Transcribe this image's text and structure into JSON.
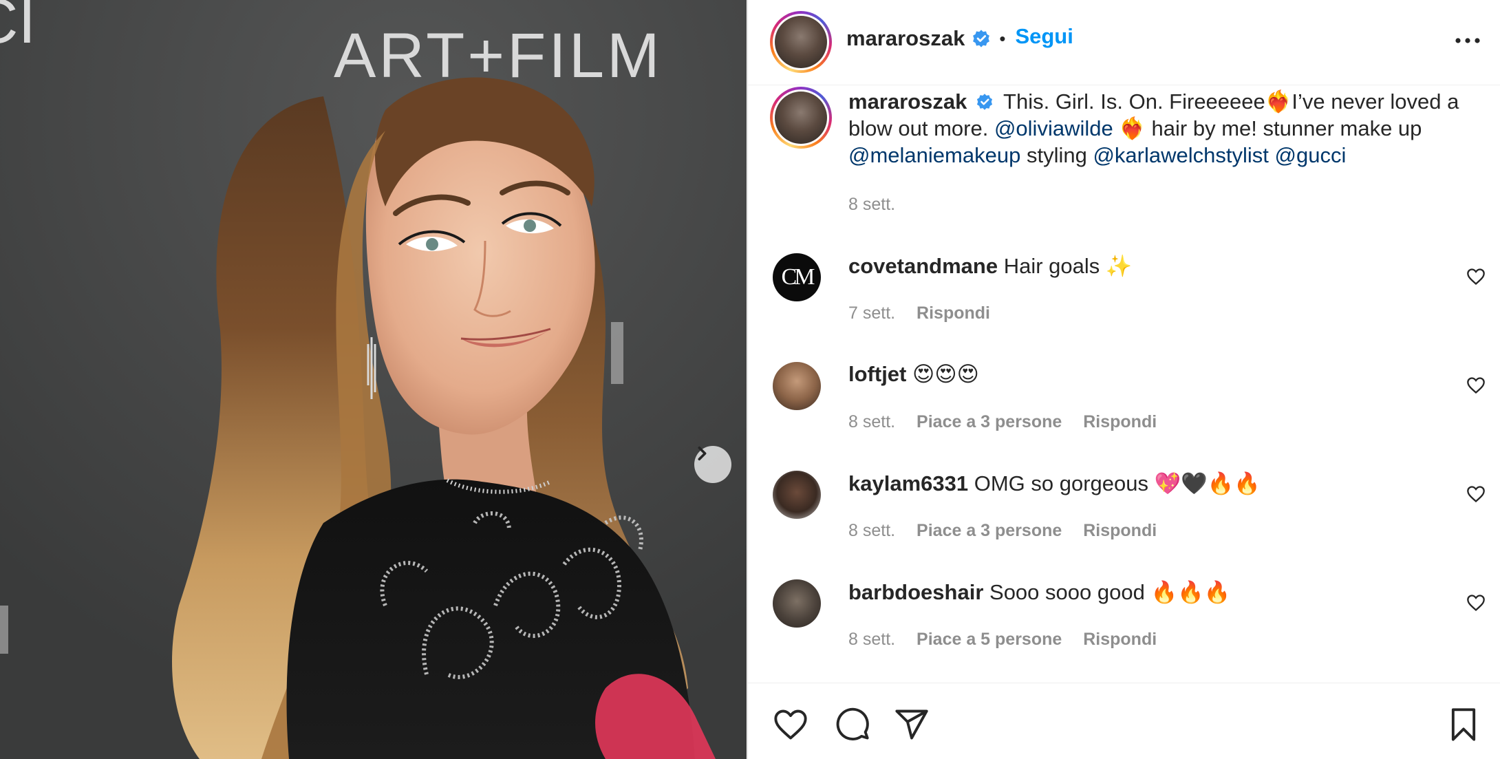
{
  "post": {
    "author": "mararoszak",
    "follow_label": "Segui",
    "separator": "•",
    "more_icon": "more-horizontal-icon",
    "photo": {
      "backdrop_text": "ART+FILM",
      "corner_text": "CI",
      "next_icon": "chevron-right-icon"
    }
  },
  "caption": {
    "author": "mararoszak",
    "text_1": "This. Girl. Is. On. Fireeeeee❤️‍🔥I’ve never loved a blow out more.",
    "mention_1": "@oliviawilde",
    "text_2": "❤️‍🔥 hair by me! stunner make up",
    "mention_2": "@melaniemakeup",
    "text_3": "styling",
    "mention_3": "@karlawelchstylist",
    "mention_4": "@gucci",
    "time": "8 sett."
  },
  "comments": [
    {
      "user": "covetandmane",
      "text": "Hair goals ✨",
      "time": "7 sett.",
      "likes": "",
      "reply": "Rispondi",
      "avatar_text": "CM"
    },
    {
      "user": "loftjet",
      "text": "😍😍😍",
      "time": "8 sett.",
      "likes": "Piace a 3 persone",
      "reply": "Rispondi"
    },
    {
      "user": "kaylam6331",
      "text": "OMG so gorgeous 💖🖤🔥🔥",
      "time": "8 sett.",
      "likes": "Piace a 3 persone",
      "reply": "Rispondi"
    },
    {
      "user": "barbdoeshair",
      "text": "Sooo sooo good 🔥🔥🔥",
      "time": "8 sett.",
      "likes": "Piace a 5 persone",
      "reply": "Rispondi"
    }
  ],
  "actions": {
    "like_icon": "heart-icon",
    "comment_icon": "comment-icon",
    "share_icon": "paper-plane-icon",
    "save_icon": "bookmark-icon"
  },
  "colors": {
    "link_blue": "#0095f6",
    "mention_blue": "#00376b",
    "verified_blue": "#3897f0",
    "meta_gray": "#8e8e8e"
  }
}
